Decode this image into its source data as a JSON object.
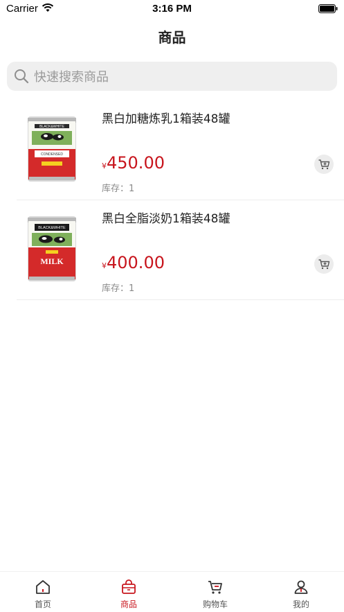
{
  "status_bar": {
    "carrier": "Carrier",
    "time": "3:16 PM"
  },
  "header": {
    "title": "商品"
  },
  "search": {
    "placeholder": "快速搜索商品"
  },
  "products": [
    {
      "name": "黑白加糖炼乳1箱装48罐",
      "currency": "¥",
      "price": "450.00",
      "stock": "库存：1",
      "image": "condensed-milk-can"
    },
    {
      "name": "黑白全脂淡奶1箱装48罐",
      "currency": "¥",
      "price": "400.00",
      "stock": "库存：1",
      "image": "evaporated-milk-can"
    }
  ],
  "can_labels": {
    "brand": "BLACK&WHITE",
    "condensed": "CONDENSED",
    "milk": "MILK"
  },
  "tabs": [
    {
      "label": "首页",
      "icon": "home-icon"
    },
    {
      "label": "商品",
      "icon": "shopping-bag-icon",
      "active": true
    },
    {
      "label": "购物车",
      "icon": "cart-icon"
    },
    {
      "label": "我的",
      "icon": "user-icon"
    }
  ],
  "colors": {
    "accent": "#c8151d",
    "text": "#222222",
    "muted": "#8a8a8a",
    "search_bg": "#efefef"
  }
}
